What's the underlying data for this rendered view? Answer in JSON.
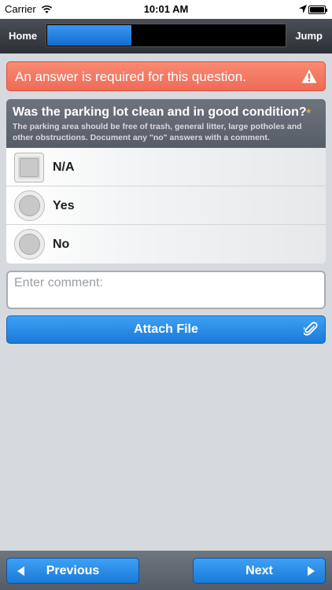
{
  "status_bar": {
    "carrier": "Carrier",
    "time": "10:01 AM"
  },
  "nav": {
    "home_label": "Home",
    "jump_label": "Jump",
    "progress_fraction": 0.36
  },
  "error": {
    "message": "An answer is required for this question.",
    "icon": "warning-icon"
  },
  "question": {
    "title": "Was the parking lot clean and in good condition?",
    "required_marker": "*",
    "description": "The parking area should be free of trash, general litter, large potholes and other obstructions. Document any \"no\" answers with a comment."
  },
  "options": [
    {
      "label": "N/A",
      "control": "checkbox"
    },
    {
      "label": "Yes",
      "control": "radio"
    },
    {
      "label": "No",
      "control": "radio"
    }
  ],
  "comment": {
    "placeholder": "Enter comment:",
    "value": ""
  },
  "attach": {
    "label": "Attach File",
    "icon": "paperclip-icon"
  },
  "footer": {
    "previous_label": "Previous",
    "next_label": "Next"
  },
  "colors": {
    "accent": "#1a7ad8",
    "error": "#ee6b56",
    "required": "#f2a23a"
  }
}
